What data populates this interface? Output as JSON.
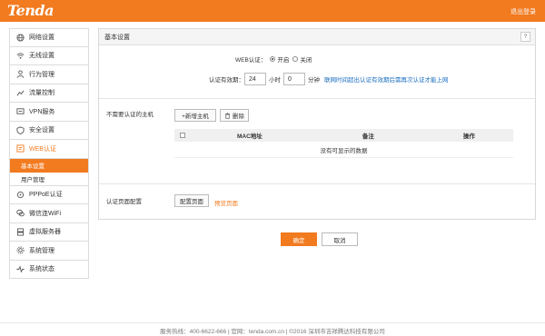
{
  "brand": {
    "logo": "Tenda",
    "logout": "退出登录"
  },
  "sidebar": {
    "items": [
      {
        "label": "网络设置",
        "icon": "globe-icon"
      },
      {
        "label": "无线设置",
        "icon": "wifi-icon"
      },
      {
        "label": "行为管理",
        "icon": "person-icon"
      },
      {
        "label": "流量控制",
        "icon": "chart-icon"
      },
      {
        "label": "VPN服务",
        "icon": "vpn-icon"
      },
      {
        "label": "安全设置",
        "icon": "shield-icon"
      },
      {
        "label": "WEB认证",
        "icon": "web-auth-icon"
      },
      {
        "label": "PPPoE认证",
        "icon": "pppoe-icon"
      },
      {
        "label": "微信连WiFi",
        "icon": "wechat-icon"
      },
      {
        "label": "虚拟服务器",
        "icon": "server-icon"
      },
      {
        "label": "系统管理",
        "icon": "gear-icon"
      },
      {
        "label": "系统状态",
        "icon": "status-icon"
      }
    ],
    "subitems": [
      {
        "label": "基本设置"
      },
      {
        "label": "用户管理"
      }
    ]
  },
  "panel": {
    "title": "基本设置",
    "help": "?",
    "web_auth_label": "WEB认证：",
    "opt_on": "开启",
    "opt_off": "关闭",
    "validity_label": "认证有效期：",
    "hours_value": "24",
    "hours_unit": "小时",
    "minutes_value": "0",
    "minutes_unit": "分钟",
    "validity_hint": "联网时间超出认证有效期后需再次认证才能上网",
    "exempt_label": "不需要认证的主机",
    "add_host": "+新增主机",
    "delete": "删除",
    "table": {
      "headers": [
        "MAC地址",
        "备注",
        "操作"
      ],
      "empty": "没有可显示的数据"
    },
    "page_config_label": "认证页面配置",
    "config_page": "配置页面",
    "preview_page": "预览页面"
  },
  "actions": {
    "ok": "确定",
    "cancel": "取消"
  },
  "footer": {
    "text": "服务热线：400-6622-666 | 官网：tenda.com.cn | ©2016 深圳市吉祥腾达科技有限公司"
  },
  "colors": {
    "accent": "#f27a1f",
    "link": "#1a6ec0"
  }
}
